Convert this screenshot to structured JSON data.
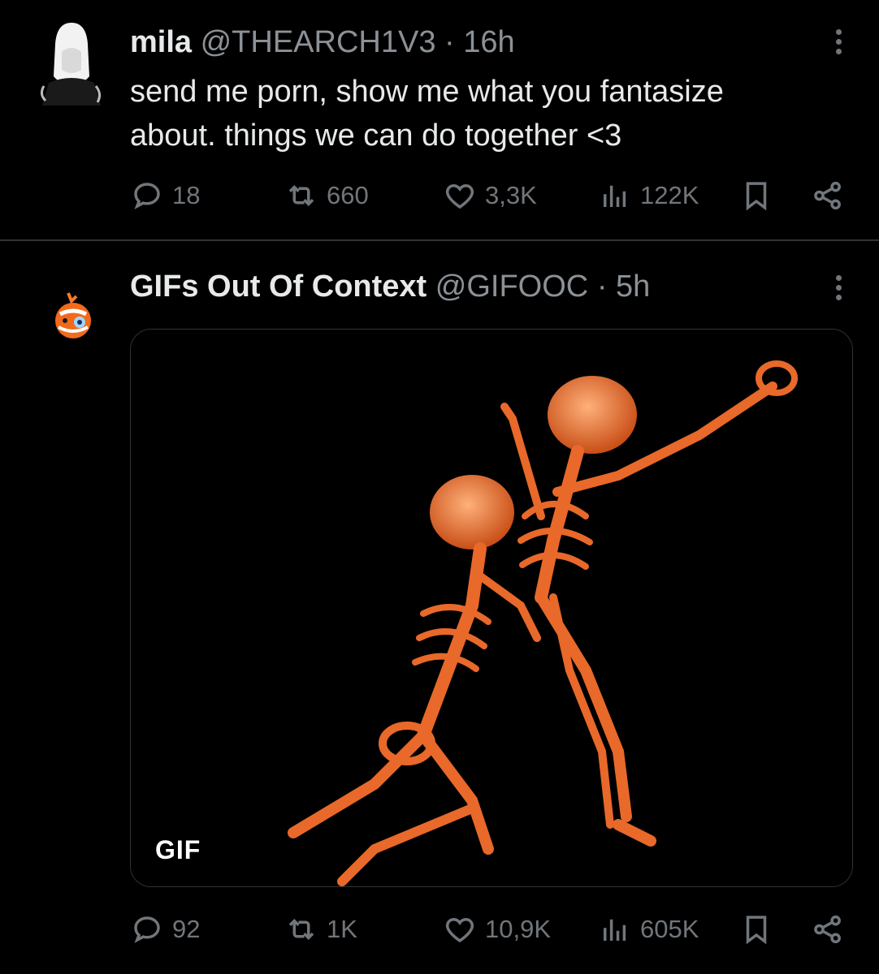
{
  "tweet1": {
    "name": "mila",
    "handle": "@THEARCH1V3",
    "separator": "·",
    "time": "16h",
    "text_line1": "send me porn, show me what you fantasize",
    "text_line2": "about. things we can do together <3",
    "stats": {
      "replies": "18",
      "reposts": "660",
      "likes": "3,3K",
      "views": "122K"
    }
  },
  "tweet2": {
    "name": "GIFs Out Of Context",
    "handle": "@GIFOOC",
    "separator": "·",
    "time": "5h",
    "media_badge": "GIF",
    "stats": {
      "replies": "92",
      "reposts": "1K",
      "likes": "10,9K",
      "views": "605K"
    }
  },
  "colors": {
    "background": "#000000",
    "text": "#e7e9ea",
    "muted": "#71767b",
    "divider": "#2f3336",
    "skeleton": "#e8692a"
  }
}
